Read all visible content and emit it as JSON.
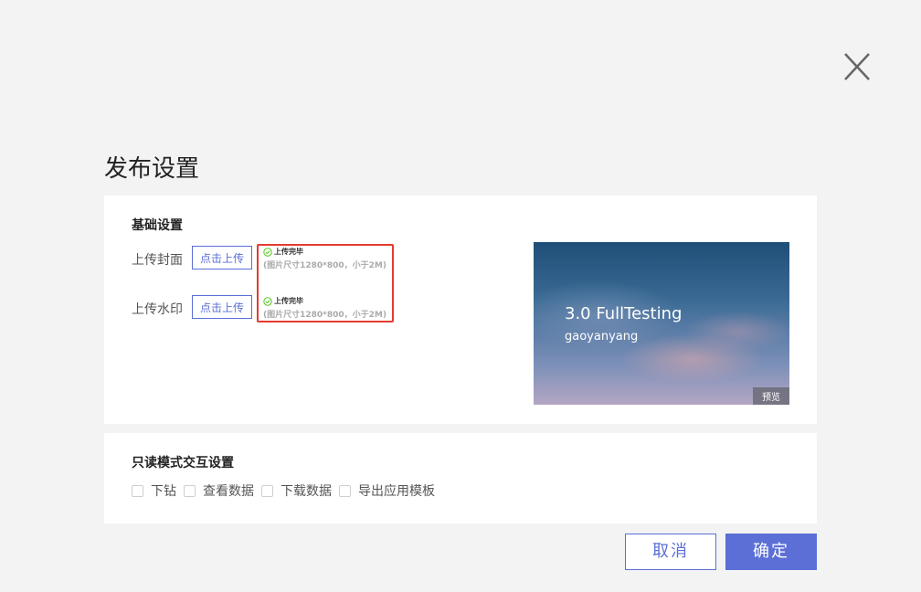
{
  "page": {
    "title": "发布设置",
    "close_icon": "close-icon"
  },
  "basic": {
    "title": "基础设置",
    "cover": {
      "label": "上传封面",
      "button": "点击上传",
      "status": "上传完毕",
      "hint": "(图片尺寸1280*800，小于2M)"
    },
    "watermark": {
      "label": "上传水印",
      "button": "点击上传",
      "status": "上传完毕",
      "hint": "(图片尺寸1280*800，小于2M)"
    },
    "preview": {
      "title": "3.0 FullTesting",
      "subtitle": "gaoyanyang",
      "badge": "预览"
    }
  },
  "readonly": {
    "title": "只读模式交互设置",
    "options": [
      {
        "label": "下钻",
        "checked": false
      },
      {
        "label": "查看数据",
        "checked": false
      },
      {
        "label": "下载数据",
        "checked": false
      },
      {
        "label": "导出应用模板",
        "checked": false
      }
    ]
  },
  "footer": {
    "cancel": "取消",
    "confirm": "确定"
  },
  "colors": {
    "accent": "#5b6fd6",
    "highlight": "#e53b30",
    "success": "#52c41a",
    "background": "#f3f3f3"
  }
}
